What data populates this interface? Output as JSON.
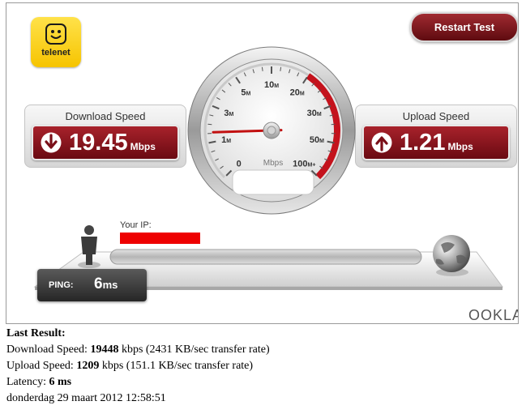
{
  "brand": {
    "logo_text": "telenet",
    "footer_logo": "OOKLA",
    "logo_icon": "smiley-icon"
  },
  "header": {
    "restart_label": "Restart Test"
  },
  "download": {
    "title": "Download Speed",
    "value": "19.45",
    "unit": "Mbps",
    "icon": "download-arrow-icon"
  },
  "upload": {
    "title": "Upload Speed",
    "value": "1.21",
    "unit": "Mbps",
    "icon": "upload-arrow-icon"
  },
  "gauge": {
    "unit_label": "Mbps",
    "ticks": [
      {
        "num": "0",
        "sub": ""
      },
      {
        "num": "1",
        "sub": "M"
      },
      {
        "num": "3",
        "sub": "M"
      },
      {
        "num": "5",
        "sub": "M"
      },
      {
        "num": "10",
        "sub": "M"
      },
      {
        "num": "20",
        "sub": "M"
      },
      {
        "num": "30",
        "sub": "M"
      },
      {
        "num": "50",
        "sub": "M"
      },
      {
        "num": "100",
        "sub": "M+"
      }
    ],
    "needle_position": 0.16,
    "accent_color": "#c4121c"
  },
  "network": {
    "ip_label": "Your IP:",
    "ip_mask_color": "#ee0000",
    "user_icon": "person-icon",
    "server_icon": "globe-icon"
  },
  "ping": {
    "label": "PING:",
    "value": "6",
    "unit": "ms"
  },
  "last_result": {
    "heading": "Last Result:",
    "download_prefix": "Download Speed: ",
    "download_kbps": "19448",
    "download_suffix": " kbps (2431 KB/sec transfer rate)",
    "upload_prefix": "Upload Speed: ",
    "upload_kbps": "1209",
    "upload_suffix": " kbps (151.1 KB/sec transfer rate)",
    "latency_prefix": "Latency: ",
    "latency_value": "6 ms",
    "timestamp": "donderdag 29 maart 2012 12:58:51"
  },
  "colors": {
    "brand_red": "#8b1a22",
    "logo_yellow": "#f6c400"
  }
}
